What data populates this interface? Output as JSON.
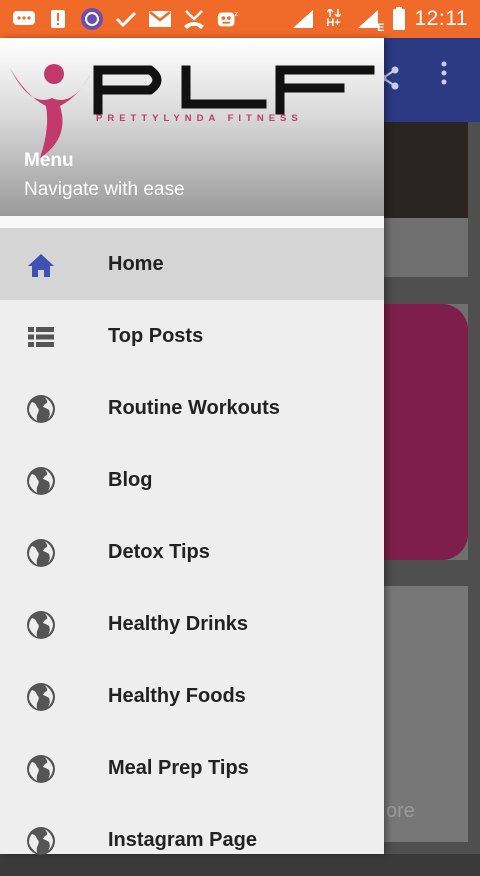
{
  "status_bar": {
    "time": "12:11",
    "network_label": "H+",
    "network_label2": "E",
    "icons": [
      "message-icon",
      "alert-icon",
      "app-icon",
      "check-icon",
      "gmail-icon",
      "missed-call-icon",
      "bot-icon",
      "signal-icon",
      "data-arrows-icon",
      "signal-icon-2",
      "battery-icon"
    ],
    "bg_color": "#f06a2a"
  },
  "drawer": {
    "logo": {
      "text": "PLF",
      "tagline": "PRETTYLYNDA FITNESS"
    },
    "title": "Menu",
    "subtitle": "Navigate with ease",
    "items": [
      {
        "label": "Home",
        "icon": "home-icon",
        "active": true
      },
      {
        "label": "Top Posts",
        "icon": "list-icon",
        "active": false
      },
      {
        "label": "Routine Workouts",
        "icon": "globe-icon",
        "active": false
      },
      {
        "label": "Blog",
        "icon": "globe-icon",
        "active": false
      },
      {
        "label": "Detox Tips",
        "icon": "globe-icon",
        "active": false
      },
      {
        "label": "Healthy Drinks",
        "icon": "globe-icon",
        "active": false
      },
      {
        "label": "Healthy Foods",
        "icon": "globe-icon",
        "active": false
      },
      {
        "label": "Meal Prep Tips",
        "icon": "globe-icon",
        "active": false
      },
      {
        "label": "Instagram Page",
        "icon": "globe-icon",
        "active": false
      }
    ],
    "accent_color": "#3f51b5"
  },
  "background_app": {
    "toolbar_color": "#2c3a84",
    "card_text": "ore"
  }
}
